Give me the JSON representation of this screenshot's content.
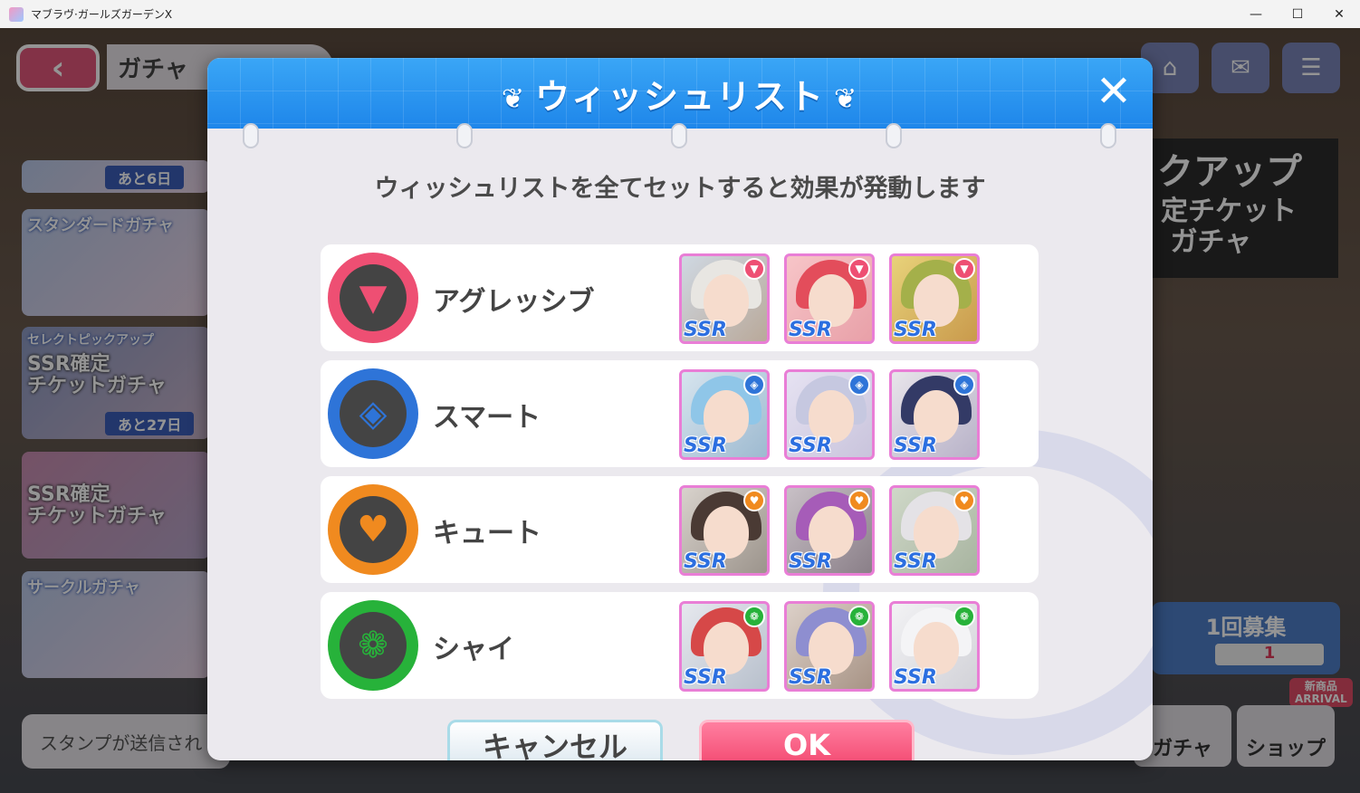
{
  "window": {
    "title": "マブラヴ·ガールズガーデンX",
    "minimize": "—",
    "maximize": "☐",
    "close": "✕"
  },
  "background": {
    "back_icon": "‹",
    "page_title": "ガチャ",
    "banners": [
      {
        "label": "",
        "days": "あと6日"
      },
      {
        "label": "スタンダードガチャ",
        "sub": "",
        "days": ""
      },
      {
        "label": "セレクトピックアップ",
        "sub": "SSR確定\nチケットガチャ",
        "days": "あと27日"
      },
      {
        "label": "",
        "sub": "SSR確定\nチケットガチャ",
        "days": ""
      },
      {
        "label": "サークルガチャ",
        "sub": "",
        "days": ""
      }
    ],
    "stamp_text": "スタンプが送信され",
    "top_icons": [
      "home-icon",
      "mail-icon",
      "menu-icon"
    ],
    "right_banner_line1": "クアップ",
    "right_banner_line2": "定チケット\n ガチャ",
    "recruit_label": "1回募集",
    "recruit_count": "1",
    "new_badge": "新商品\nARRIVAL",
    "nav_gacha": "ガチャ",
    "nav_shop": "ショップ"
  },
  "dialog": {
    "title": "ウィッシュリスト",
    "close_icon": "✕",
    "instruction": "ウィッシュリストを全てセットすると効果が発動します",
    "rows": [
      {
        "label": "アグレッシブ",
        "color": "#ee4f73",
        "icon": "aggressive-icon"
      },
      {
        "label": "スマート",
        "color": "#2e74d8",
        "icon": "smart-icon"
      },
      {
        "label": "キュート",
        "color": "#f08a1f",
        "icon": "cute-icon"
      },
      {
        "label": "シャイ",
        "color": "#27b23a",
        "icon": "shy-icon"
      }
    ],
    "rarity_label": "SSR",
    "cancel_label": "キャンセル",
    "ok_label": "OK"
  }
}
